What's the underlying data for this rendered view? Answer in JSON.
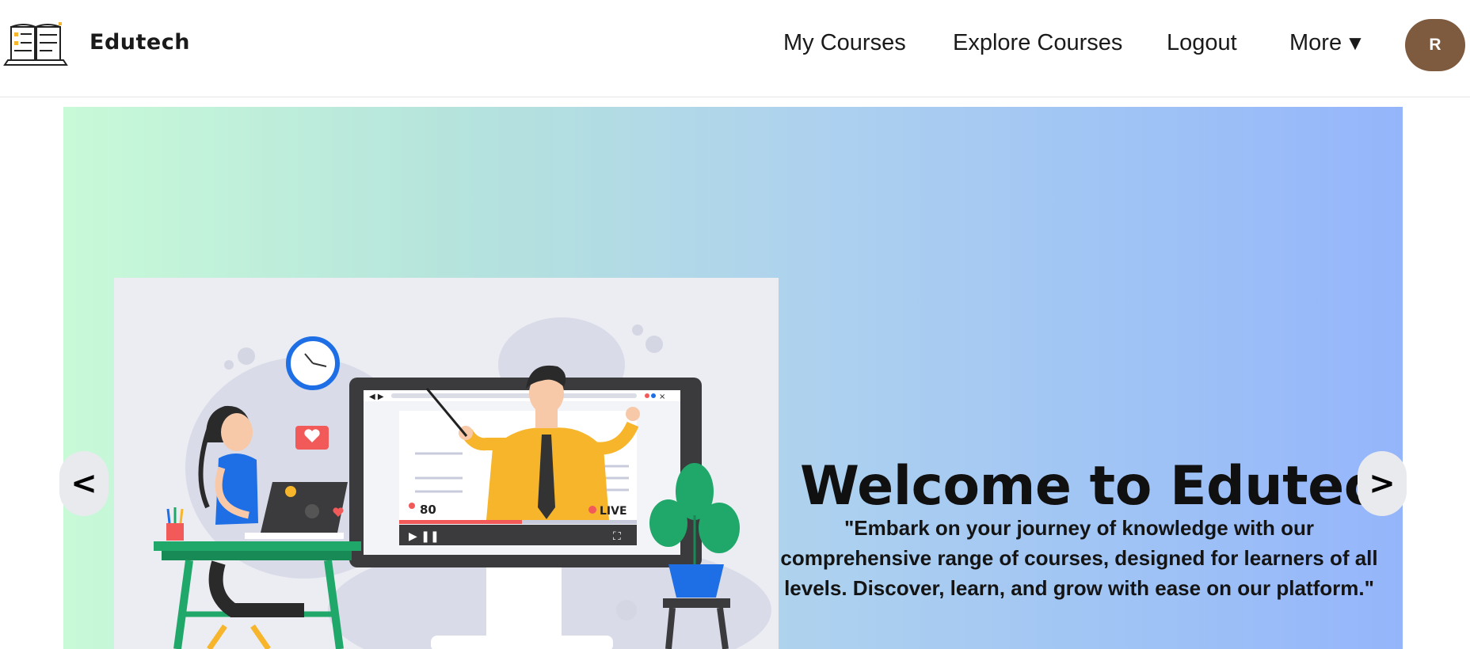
{
  "header": {
    "brand": "Edutech",
    "nav": {
      "my_courses": "My Courses",
      "explore_courses": "Explore Courses",
      "logout": "Logout",
      "more": "More",
      "more_caret": "▼"
    },
    "avatar_initial": "R"
  },
  "hero": {
    "title": "Welcome to Edutech!",
    "text": "\"Embark on your journey of knowledge with our comprehensive range of courses, designed for learners of all levels. Discover, learn, and grow with ease on our platform.\"",
    "prev_label": "<",
    "next_label": ">",
    "illustration": {
      "viewer_count": "80",
      "live_label": "LIVE"
    }
  },
  "colors": {
    "avatar": "#7e5b3f",
    "gradient_start": "#c8fad8",
    "gradient_end": "#95b5fb",
    "accent_yellow": "#f7b52c",
    "accent_blue": "#1e6fe6"
  }
}
